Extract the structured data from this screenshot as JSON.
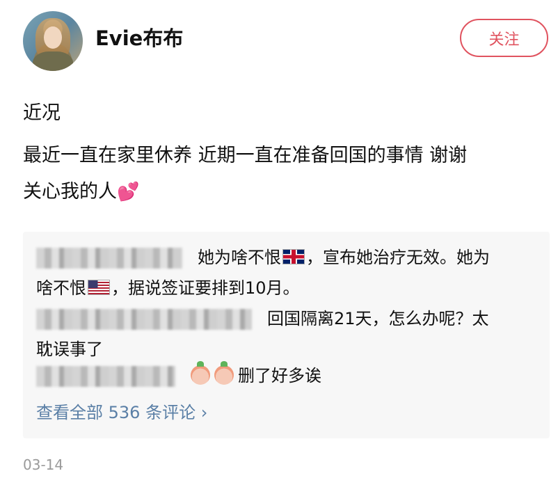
{
  "post": {
    "username": "Evie布布",
    "follow_label": "关注",
    "title": "近况",
    "body_line1": "最近一直在家里休养 近期一直在准备回国的事情 谢谢",
    "body_line2": "关心我的人",
    "heart_emoji": "💕",
    "date": "03-14"
  },
  "comments": [
    {
      "text_a": "她为啥不恨",
      "text_b": "，宣布她治疗无效。她为",
      "text_c": "啥不恨",
      "text_d": "，据说签证要排到10月。"
    },
    {
      "text_a": "回国隔离21天，怎么办呢？太",
      "text_b": "耽误事了"
    },
    {
      "text": "删了好多诶"
    }
  ],
  "view_all_label": "查看全部 536 条评论 ›",
  "colors": {
    "accent": "#e0535f",
    "link": "#5a7fa6",
    "comment_bg": "#f7f7f7"
  }
}
